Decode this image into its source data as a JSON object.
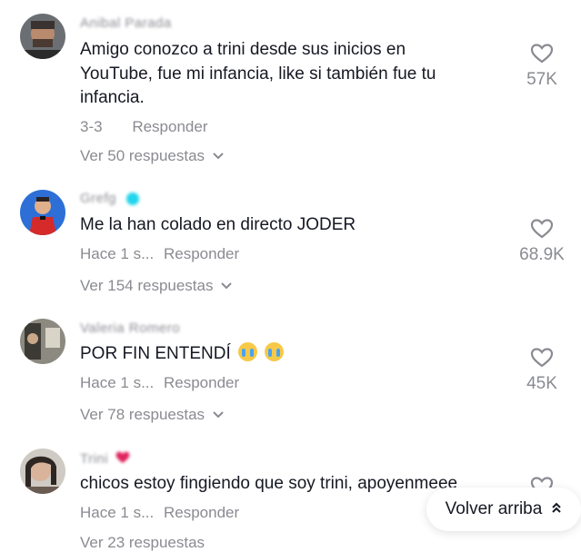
{
  "comments": [
    {
      "username": "Anibal Parada",
      "text": "Amigo conozco a trini desde sus inicios en YouTube, fue mi infancia, like si también fue tu infancia.",
      "date": "3-3",
      "reply_label": "Responder",
      "view_replies": "Ver 50 respuestas",
      "likes": "57K"
    },
    {
      "username": "Grefg",
      "text": "Me la han colado en directo JODER",
      "date": "Hace 1 s...",
      "reply_label": "Responder",
      "view_replies": "Ver 154 respuestas",
      "likes": "68.9K"
    },
    {
      "username": "Valeria Romero",
      "text": "POR FIN ENTENDÍ",
      "date": "Hace 1 s...",
      "reply_label": "Responder",
      "view_replies": "Ver 78 respuestas",
      "likes": "45K"
    },
    {
      "username": "Trini",
      "text": "chicos estoy fingiendo que soy trini, apoyenmeee",
      "date": "Hace 1 s...",
      "reply_label": "Responder",
      "view_replies": "Ver 23 respuestas",
      "likes": ""
    }
  ],
  "back_to_top": {
    "label": "Volver arriba"
  },
  "icons": {
    "like": "heart-outline-icon",
    "expand": "chevron-down-icon",
    "back_top": "double-chevron-up-icon"
  },
  "colors": {
    "secondary_text": "#8a8b91",
    "primary_text": "#161823",
    "verified": "#20d5ec"
  }
}
